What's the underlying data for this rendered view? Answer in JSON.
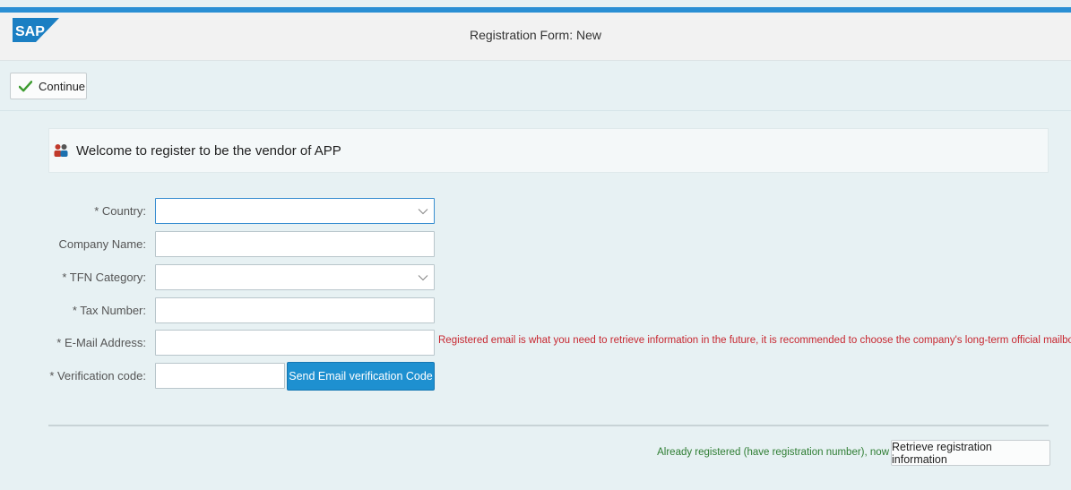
{
  "shell": {
    "logo_text": "SAP",
    "title": "Registration Form: New"
  },
  "toolbar": {
    "continue_label": "Continue",
    "continue_icon": "checkmark-icon"
  },
  "welcome": {
    "icon": "people-icon",
    "text": "Welcome to register to be the vendor of APP"
  },
  "form": {
    "country_label": "* Country:",
    "country_value": "",
    "company_name_label": "Company Name:",
    "company_name_value": "",
    "tfn_category_label": "* TFN Category:",
    "tfn_category_value": "",
    "tax_number_label": "* Tax Number:",
    "tax_number_value": "",
    "email_label": "* E-Mail Address:",
    "email_value": "",
    "email_hint": "Registered email is what you need to retrieve information in the future, it is recommended to choose the company's long-term official mailbox",
    "verification_label": "* Verification code:",
    "verification_value": "",
    "send_code_label": "Send Email verification Code"
  },
  "footer": {
    "registered_text": "Already registered (have registration number), now",
    "retrieve_label": "Retrieve registration information"
  },
  "colors": {
    "accent": "#1e90d0",
    "error": "#c7262f",
    "success_text": "#2e7d32",
    "page_bg": "#e7f1f3"
  }
}
